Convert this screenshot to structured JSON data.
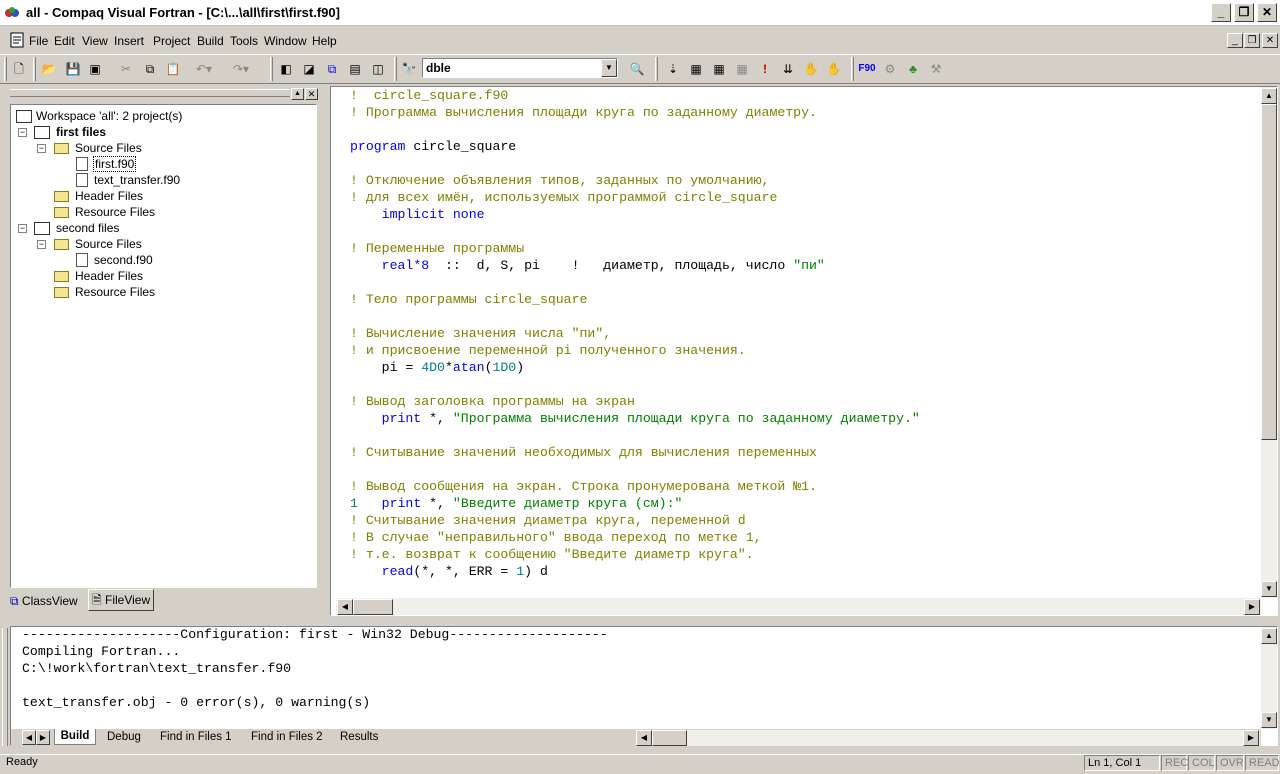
{
  "window": {
    "title": "all - Compaq Visual Fortran - [C:\\...\\all\\first\\first.f90]"
  },
  "menu": [
    "File",
    "Edit",
    "View",
    "Insert",
    "Project",
    "Build",
    "Tools",
    "Window",
    "Help"
  ],
  "toolbar": {
    "combo_value": "dble"
  },
  "workspace": {
    "root": "Workspace 'all': 2 project(s)",
    "nodes": [
      "first files",
      "Source Files",
      "first.f90",
      "text_transfer.f90",
      "Header Files",
      "Resource Files",
      "second files",
      "Source Files",
      "second.f90",
      "Header Files",
      "Resource Files"
    ],
    "tabs": [
      "ClassView",
      "FileView"
    ]
  },
  "editor": {
    "lines": [
      {
        "m": "!",
        "t": "  circle_square.f90",
        "c": "cm"
      },
      {
        "m": "!",
        "t": " Программа вычисления площади круга по заданному диаметру.",
        "c": "cm"
      },
      {
        "m": "",
        "t": "",
        "c": ""
      },
      {
        "m": "",
        "t": "program circle_square",
        "c": "prog"
      },
      {
        "m": "",
        "t": "",
        "c": ""
      },
      {
        "m": "!",
        "t": " Отключение объявления типов, заданных по умолчанию,",
        "c": "cm"
      },
      {
        "m": "!",
        "t": " для всех имён, используемых программой circle_square",
        "c": "cm"
      },
      {
        "m": "",
        "t": "    implicit none",
        "c": "kw"
      },
      {
        "m": "",
        "t": "",
        "c": ""
      },
      {
        "m": "!",
        "t": " Переменные программы",
        "c": "cm"
      },
      {
        "m": "",
        "t": "    real*8  ::  d, S, pi    !   диаметр, площадь, число \"пи\"",
        "c": "decl"
      },
      {
        "m": "",
        "t": "",
        "c": ""
      },
      {
        "m": "!",
        "t": " Тело программы circle_square",
        "c": "cm"
      },
      {
        "m": "",
        "t": "",
        "c": ""
      },
      {
        "m": "!",
        "t": " Вычисление значения числа \"пи\",",
        "c": "cm"
      },
      {
        "m": "!",
        "t": " и присвоение переменной pi полученного значения.",
        "c": "cm"
      },
      {
        "m": "",
        "t": "    pi = 4D0*atan(1D0)",
        "c": "assign"
      },
      {
        "m": "",
        "t": "",
        "c": ""
      },
      {
        "m": "!",
        "t": " Вывод заголовка программы на экран",
        "c": "cm"
      },
      {
        "m": "",
        "t": "    print *, \"Программа вычисления площади круга по заданному диаметру.\"",
        "c": "print"
      },
      {
        "m": "",
        "t": "",
        "c": ""
      },
      {
        "m": "!",
        "t": " Считывание значений необходимых для вычисления переменных",
        "c": "cm"
      },
      {
        "m": "",
        "t": "",
        "c": ""
      },
      {
        "m": "!",
        "t": " Вывод сообщения на экран. Строка пронумерована меткой №1.",
        "c": "cm"
      },
      {
        "m": "1",
        "t": "   print *, \"Введите диаметр круга (см):\"",
        "c": "print"
      },
      {
        "m": "!",
        "t": " Считывание значения диаметра круга, переменной d",
        "c": "cm"
      },
      {
        "m": "!",
        "t": " В случае \"неправильного\" ввода переход по метке 1,",
        "c": "cm"
      },
      {
        "m": "!",
        "t": " т.е. возврат к сообщению \"Введите диаметр круга\".",
        "c": "cm"
      },
      {
        "m": "",
        "t": "    read(*, *, ERR = 1) d",
        "c": "read"
      }
    ]
  },
  "output": {
    "lines": [
      "--------------------Configuration: first - Win32 Debug--------------------",
      "Compiling Fortran...",
      "C:\\!work\\fortran\\text_transfer.f90",
      "",
      "text_transfer.obj - 0 error(s), 0 warning(s)"
    ],
    "tabs": [
      "Build",
      "Debug",
      "Find in Files 1",
      "Find in Files 2",
      "Results"
    ]
  },
  "status": {
    "text": "Ready",
    "position": "Ln 1, Col 1",
    "indicators": [
      "REC",
      "COL",
      "OVR",
      "READ"
    ]
  }
}
